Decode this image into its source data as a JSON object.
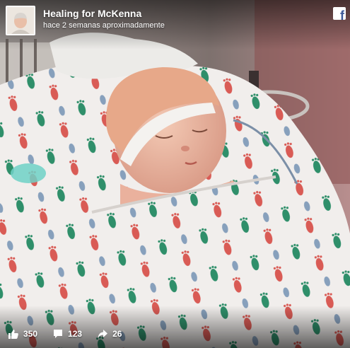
{
  "post": {
    "page_name": "Healing for McKenna",
    "timestamp": "hace 2 semanas aproximadamente",
    "brand_icon": "facebook-icon",
    "brand_color": "#3b5998"
  },
  "stats": {
    "likes": "350",
    "comments": "123",
    "shares": "26",
    "icons": [
      "thumbs-up-icon",
      "comment-icon",
      "share-icon"
    ]
  }
}
